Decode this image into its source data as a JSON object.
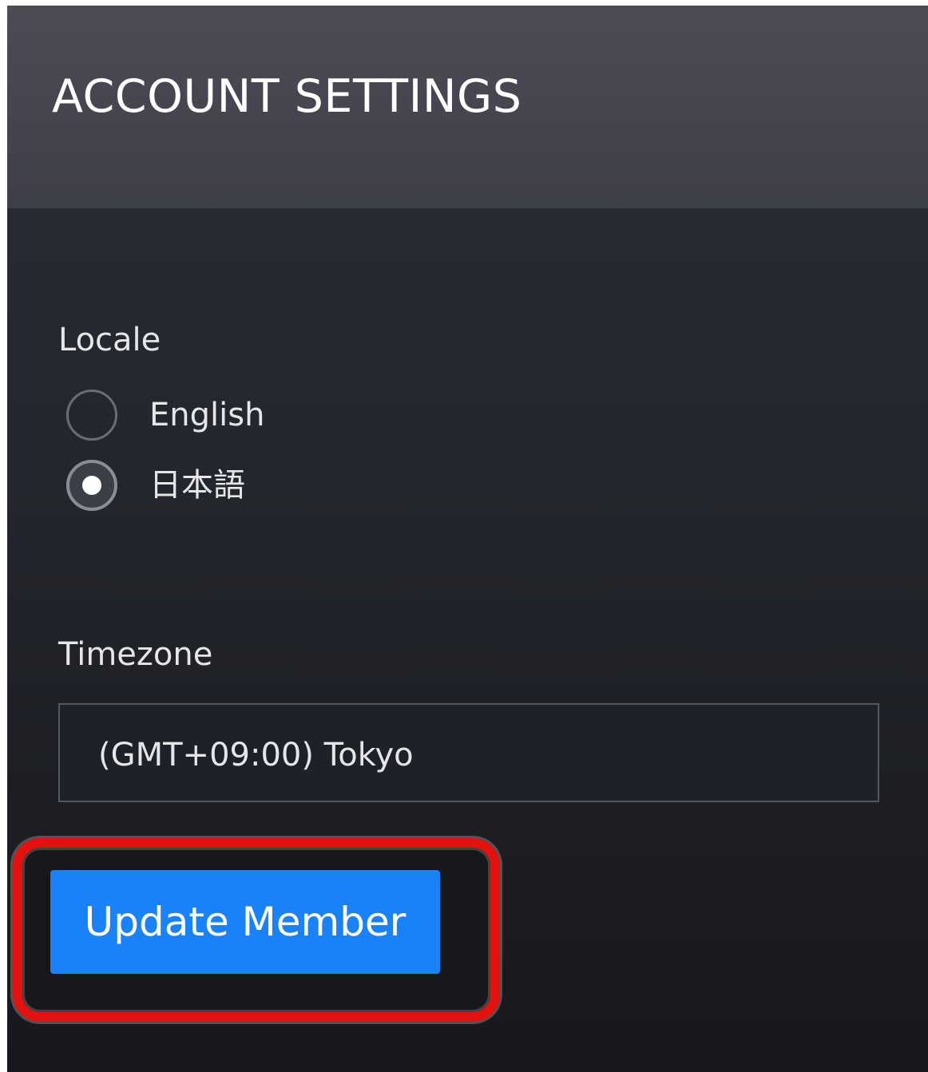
{
  "header": {
    "title": "ACCOUNT SETTINGS"
  },
  "locale": {
    "label": "Locale",
    "options": [
      {
        "label": "English",
        "selected": false
      },
      {
        "label": "日本語",
        "selected": true
      }
    ]
  },
  "timezone": {
    "label": "Timezone",
    "value": "(GMT+09:00) Tokyo"
  },
  "actions": {
    "update_label": "Update Member"
  },
  "colors": {
    "accent": "#1a82f7",
    "highlight": "#e4120f"
  }
}
